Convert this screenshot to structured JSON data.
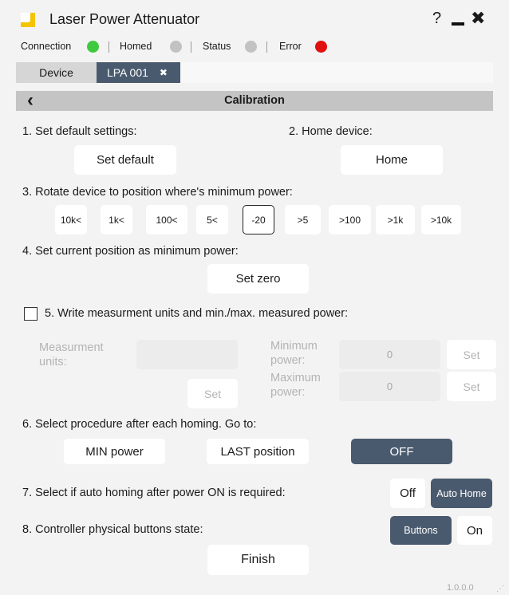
{
  "app": {
    "title": "Laser Power Attenuator",
    "help_icon": "question-mark-icon",
    "minimize_icon": "minimize-icon",
    "close_icon": "close-icon",
    "logo_icon": "yellow-square-logo-icon"
  },
  "status_bar": {
    "connection": {
      "label": "Connection",
      "color": "#3ec93e"
    },
    "homed": {
      "label": "Homed",
      "color": "#c2c2c2"
    },
    "status": {
      "label": "Status",
      "color": "#c2c2c2"
    },
    "error": {
      "label": "Error",
      "color": "#e01010"
    }
  },
  "tabs": [
    {
      "label": "Device",
      "active": false
    },
    {
      "label": "LPA 001",
      "active": true,
      "close_glyph": "✖"
    }
  ],
  "section": {
    "title": "Calibration",
    "back_icon": "chevron-left-icon"
  },
  "step1": {
    "label": "1. Set default settings:",
    "button": "Set default"
  },
  "step2": {
    "label": "2. Home device:",
    "button": "Home"
  },
  "step3": {
    "label": "3. Rotate device to position where's minimum power:",
    "buttons": [
      "10k<",
      "1k<",
      "100<",
      "5<",
      "-20",
      ">5",
      ">100",
      ">1k",
      ">10k"
    ],
    "selected": "-20"
  },
  "step4": {
    "label": "4. Set current position as minimum power:",
    "button": "Set zero"
  },
  "step5": {
    "label": "5. Write measurment units and min./max. measured power:",
    "checked": false,
    "units_label": "Measurment units:",
    "units_value": "",
    "units_set": "Set",
    "min_label": "Minimum power:",
    "min_value": "0",
    "min_set": "Set",
    "max_label": "Maximum power:",
    "max_value": "0",
    "max_set": "Set"
  },
  "step6": {
    "label": "6. Select procedure after each homing. Go to:",
    "options": [
      "MIN power",
      "LAST position",
      "OFF"
    ],
    "selected": "OFF"
  },
  "step7": {
    "label": "7. Select if auto homing after power ON is required:",
    "options": [
      "Off",
      "Auto Home"
    ],
    "selected": "Auto Home"
  },
  "step8": {
    "label": "8. Controller physical buttons state:",
    "options": [
      "Buttons",
      "On"
    ],
    "selected": "Buttons"
  },
  "finish_button": "Finish",
  "version": "1.0.0.0",
  "colors": {
    "accent": "#4a5a6e",
    "logo": "#f5c400",
    "section_bar": "#c4c4c4"
  }
}
